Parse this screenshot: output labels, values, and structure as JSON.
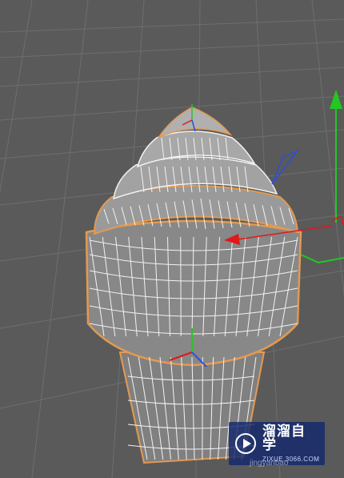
{
  "viewport": {
    "background": "#5a5a5a",
    "grid_color": "#6e6e6e",
    "mesh_fill": "#8a8a8a",
    "mesh_lines": "#f2f2f2",
    "selection_outline": "#e39a50"
  },
  "gizmo": {
    "x_axis_color": "#e01818",
    "y_axis_color": "#22c822",
    "z_axis_color": "#2d4fd8"
  },
  "watermark": {
    "brand": "溜溜自学",
    "url": "ZIXUE.3066.COM",
    "icon": "play-icon",
    "background": "#1c2b6e"
  },
  "footer_caption": "jingyanbao"
}
